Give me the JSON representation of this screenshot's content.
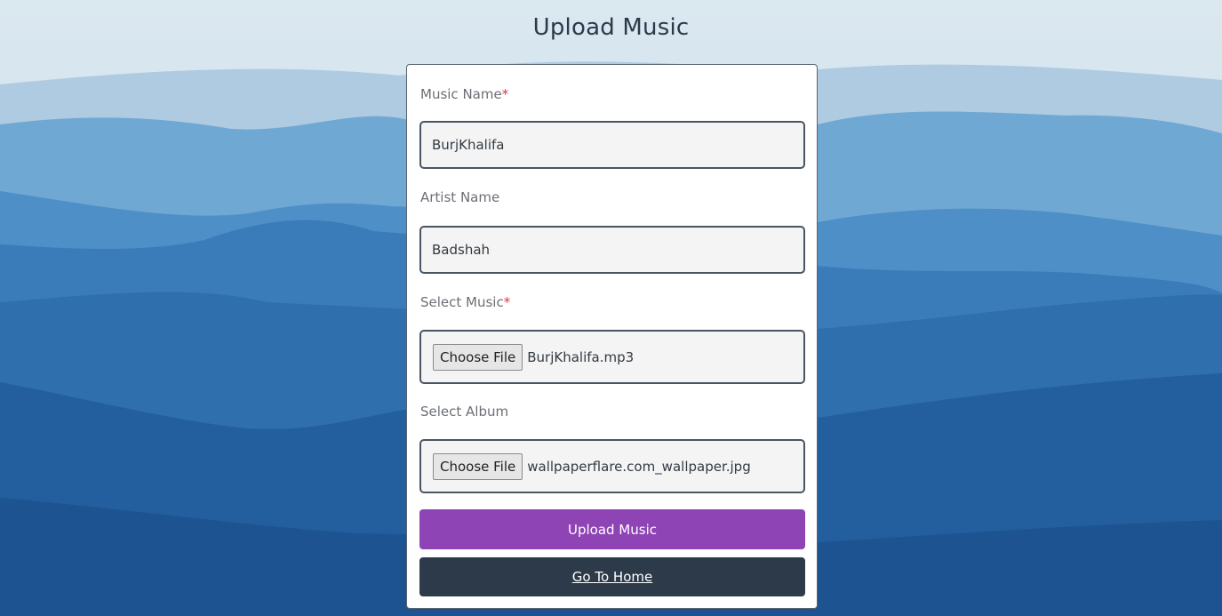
{
  "page": {
    "title": "Upload Music"
  },
  "form": {
    "music_name": {
      "label": "Music Name",
      "required_mark": "*",
      "value": "BurjKhalifa"
    },
    "artist_name": {
      "label": "Artist Name",
      "value": "Badshah"
    },
    "select_music": {
      "label": "Select Music",
      "required_mark": "*",
      "button_label": "Choose File",
      "file_name": "BurjKhalifa.mp3"
    },
    "select_album": {
      "label": "Select Album",
      "button_label": "Choose File",
      "file_name": "wallpaperflare.com_wallpaper.jpg"
    },
    "upload_button_label": "Upload Music",
    "home_button_label": "Go To Home"
  },
  "colors": {
    "upload_button": "#8e44b5",
    "home_button": "#2d3a4a",
    "required_mark": "#e0334a"
  }
}
